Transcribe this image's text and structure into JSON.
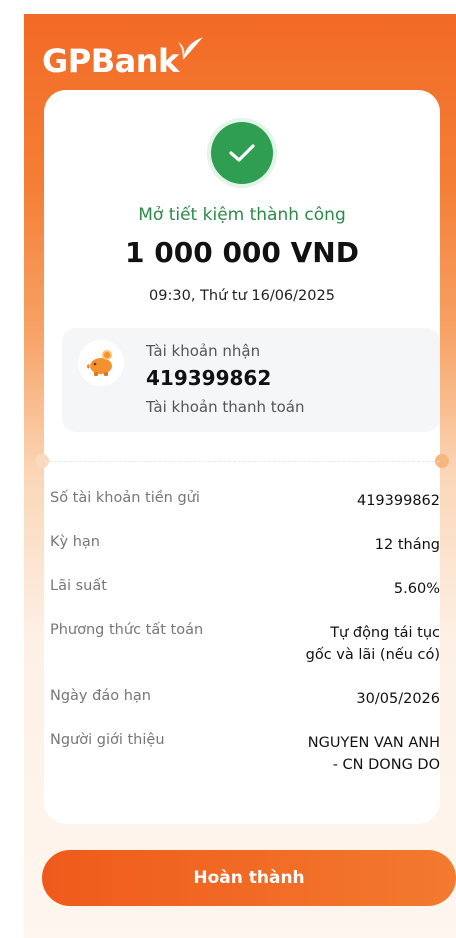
{
  "brand": {
    "name": "GPBank"
  },
  "result": {
    "status": "Mở tiết kiệm thành công",
    "amount": "1 000 000 VND",
    "datetime": "09:30, Thứ tư 16/06/2025"
  },
  "receiving_account": {
    "label": "Tài khoản nhận",
    "number": "419399862",
    "type": "Tài khoản thanh toán"
  },
  "details": [
    {
      "label": "Số tài khoản tiền gửi",
      "value_lines": [
        "419399862"
      ]
    },
    {
      "label": "Kỳ hạn",
      "value_lines": [
        "12 tháng"
      ]
    },
    {
      "label": "Lãi suất",
      "value_lines": [
        "5.60%"
      ]
    },
    {
      "label": "Phương thức tất toán",
      "value_lines": [
        "Tự động tái tục",
        "gốc và lãi (nếu có)"
      ]
    },
    {
      "label": "Ngày đáo hạn",
      "value_lines": [
        "30/05/2026"
      ]
    },
    {
      "label": "Người giới thiệu",
      "value_lines": [
        "NGUYEN VAN ANH",
        "- CN DONG DO"
      ]
    }
  ],
  "actions": {
    "done_label": "Hoàn thành"
  },
  "colors": {
    "brand_orange": "#f26a26",
    "success_green": "#2f9e52",
    "status_text_green": "#2b8a47"
  },
  "icons": {
    "success": "check-icon",
    "account": "piggy-bank-icon",
    "logo_mark": "leaf-icon"
  }
}
